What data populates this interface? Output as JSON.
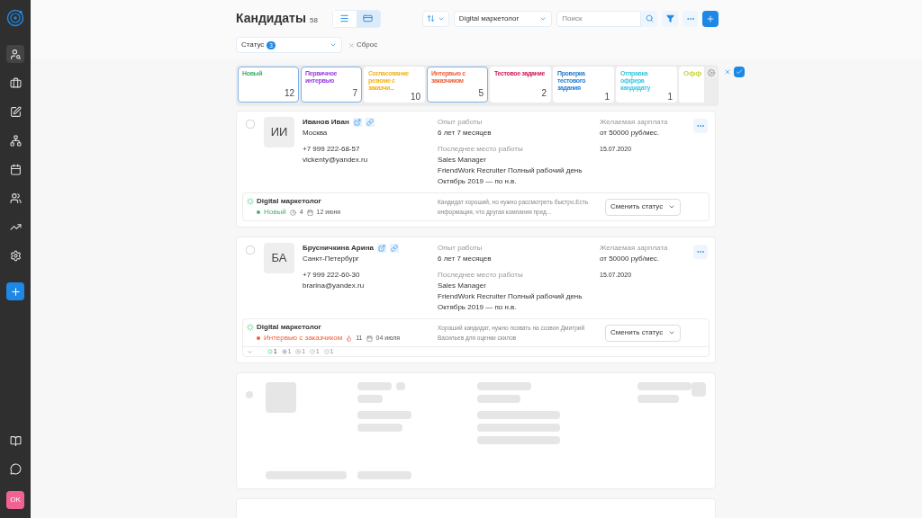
{
  "sidebar": {
    "items": [
      {
        "selected": true
      },
      {
        "selected": false
      },
      {
        "selected": false
      },
      {
        "selected": false
      },
      {
        "selected": false
      },
      {
        "selected": false
      },
      {
        "selected": false
      },
      {
        "selected": false
      }
    ],
    "user_badge": "OK"
  },
  "header": {
    "title": "Кандидаты",
    "count": "58",
    "view_modes": [
      {
        "selected": false
      },
      {
        "selected": true
      }
    ],
    "vacancy": "Digital маркетолог",
    "search_placeholder": "Поиск"
  },
  "filter": {
    "label": "Статус",
    "badge": "3",
    "reset": "Сброс"
  },
  "stages": [
    {
      "label": "Новый",
      "count": "12",
      "color": "#4caf73",
      "selected": true
    },
    {
      "label": "Первичное интервью",
      "count": "7",
      "color": "#9b3fe0",
      "selected": true
    },
    {
      "label": "Согласование резюме с заказчи...",
      "count": "10",
      "color": "#f5b31b",
      "selected": false
    },
    {
      "label": "Интервью с заказчиком",
      "count": "5",
      "color": "#f0603a",
      "selected": true
    },
    {
      "label": "Тестовое задание",
      "count": "2",
      "color": "#d3195b",
      "selected": false
    },
    {
      "label": "Проверка тестового задания",
      "count": "1",
      "color": "#2a7fd4",
      "selected": false
    },
    {
      "label": "Отправка оффера кандидату",
      "count": "1",
      "color": "#3fc7e0",
      "selected": false
    },
    {
      "label": "Офф",
      "color": "#c7d63a",
      "selected": false
    }
  ],
  "candidates": [
    {
      "initials": "ИИ",
      "name": "Иванов Иван",
      "city": "Москва",
      "phone": "+7 999 222-68-57",
      "email": "vickenty@yandex.ru",
      "checked": false,
      "experience_label": "Опыт работы",
      "experience": "6 лет 7 месяцев",
      "last_job_label": "Последнее место работы",
      "last_job": [
        "Sales Manager",
        "FriendWork Recruiter Полный рабочий день",
        "Октябрь 2019 — по н.в."
      ],
      "salary_label": "Желаемая зарплата",
      "salary": "от 50000 руб/мес.",
      "date": "15.07.2020",
      "vacancy": "Digital маркетолог",
      "status": {
        "label": "Новый",
        "color": "#4caf73"
      },
      "counter": {
        "kind": "clock",
        "value": "4"
      },
      "status_date": "12 июня",
      "comment": "Кандидат хороший, но нужно рассмотреть быстро.Есть информация, что другая компания пред...",
      "button": "Сменить статус"
    },
    {
      "initials": "БА",
      "name": "Брусничкина Арина",
      "city": "Санкт-Петербург",
      "phone": "+7 999 222-60-30",
      "email": "brarina@yandex.ru",
      "checked": false,
      "experience_label": "Опыт работы",
      "experience": "6 лет 7 месяцев",
      "last_job_label": "Последнее место работы",
      "last_job": [
        "Sales Manager",
        "FriendWork Recruiter Полный рабочий день",
        "Октябрь 2019 — по н.в."
      ],
      "salary_label": "Желаемая зарплата",
      "salary": "от 50000 руб/мес.",
      "date": "15.07.2020",
      "vacancy": "Digital маркетолог",
      "status": {
        "label": "Интервью с заказчиком",
        "color": "#f0603a"
      },
      "counter": {
        "kind": "fire",
        "value": "11"
      },
      "status_date": "04 июля",
      "comment": "Хороший кандидат, нужно позвать на созвон Дмитрий Васильев для оценки скилов",
      "button": "Сменить статус",
      "stats": [
        {
          "kind": "progress",
          "value": "1"
        },
        {
          "kind": "snow",
          "value": "1"
        },
        {
          "kind": "cross",
          "value": "1"
        },
        {
          "kind": "check",
          "value": "1"
        },
        {
          "kind": "check",
          "value": "1"
        }
      ]
    }
  ]
}
